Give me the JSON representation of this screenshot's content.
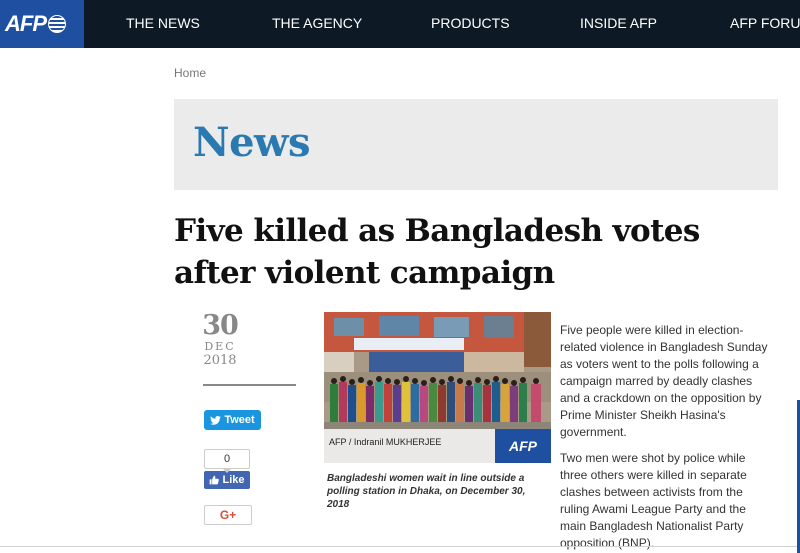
{
  "header": {
    "logo_text": "AFP",
    "nav": [
      "THE NEWS",
      "THE AGENCY",
      "PRODUCTS",
      "INSIDE AFP",
      "AFP FORUM"
    ]
  },
  "breadcrumb": "Home",
  "section_title": "News",
  "headline": "Five killed as Bangladesh votes after violent campaign",
  "date": {
    "day": "30",
    "month": "DEC",
    "year": "2018"
  },
  "share": {
    "tweet_label": "Tweet",
    "fb_count": "0",
    "fb_like_label": "Like",
    "gplus_label": "G+"
  },
  "photo": {
    "credit": "AFP / Indranil MUKHERJEE",
    "logo_text": "AFP",
    "caption": "Bangladeshi women wait in line outside a polling station in Dhaka, on December 30, 2018"
  },
  "article": {
    "paragraphs": [
      "Five people were killed in election-related violence in Bangladesh Sunday as voters went to the polls following a campaign marred by deadly clashes and a crackdown on the opposition by Prime Minister Sheikh Hasina's government.",
      "Two men were shot by police while three others were killed in separate clashes between activists from the ruling Awami League Party and the main Bangladesh Nationalist Party opposition (BNP)."
    ]
  },
  "colors": {
    "topbar": "#0d1a26",
    "logo_bg": "#1e4fa0",
    "section_title": "#2a79b0",
    "tweet": "#1b95e0",
    "fb": "#4267b2"
  }
}
